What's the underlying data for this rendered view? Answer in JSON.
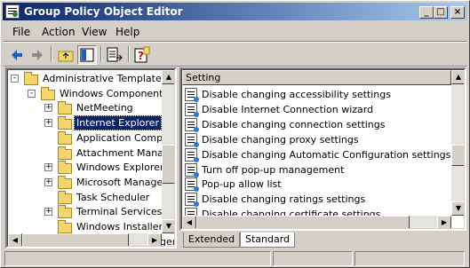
{
  "window": {
    "title": "Group Policy Object Editor"
  },
  "caption_buttons": [
    "_",
    "□",
    "×"
  ],
  "menu": [
    "File",
    "Action",
    "View",
    "Help"
  ],
  "toolbar": {
    "buttons": [
      "back-arrow-icon",
      "forward-arrow-icon",
      "up-folder-icon",
      "show-hide-tree-icon",
      "export-list-icon",
      "help-icon"
    ]
  },
  "tree": {
    "items": [
      {
        "label": "Administrative Templates",
        "level": 0,
        "expander": "-"
      },
      {
        "label": "Windows Components",
        "level": 1,
        "expander": "-"
      },
      {
        "label": "NetMeeting",
        "level": 2,
        "expander": "+"
      },
      {
        "label": "Internet Explorer",
        "level": 2,
        "expander": "+",
        "selected": true
      },
      {
        "label": "Application Compatib",
        "level": 2,
        "expander": ""
      },
      {
        "label": "Attachment Manager",
        "level": 2,
        "expander": ""
      },
      {
        "label": "Windows Explorer",
        "level": 2,
        "expander": "+"
      },
      {
        "label": "Microsoft Manageme",
        "level": 2,
        "expander": "+"
      },
      {
        "label": "Task Scheduler",
        "level": 2,
        "expander": ""
      },
      {
        "label": "Terminal Services",
        "level": 2,
        "expander": "+"
      },
      {
        "label": "Windows Installer",
        "level": 2,
        "expander": ""
      },
      {
        "label": "Windows Messenger",
        "level": 2,
        "expander": ""
      }
    ]
  },
  "list": {
    "column": "Setting",
    "items": [
      "Disable changing accessibility settings",
      "Disable Internet Connection wizard",
      "Disable changing connection settings",
      "Disable changing proxy settings",
      "Disable changing Automatic Configuration settings",
      "Turn off pop-up management",
      "Pop-up allow list",
      "Disable changing ratings settings",
      "Disable changing certificate settings"
    ]
  },
  "tabs": {
    "extended": "Extended",
    "standard": "Standard"
  }
}
